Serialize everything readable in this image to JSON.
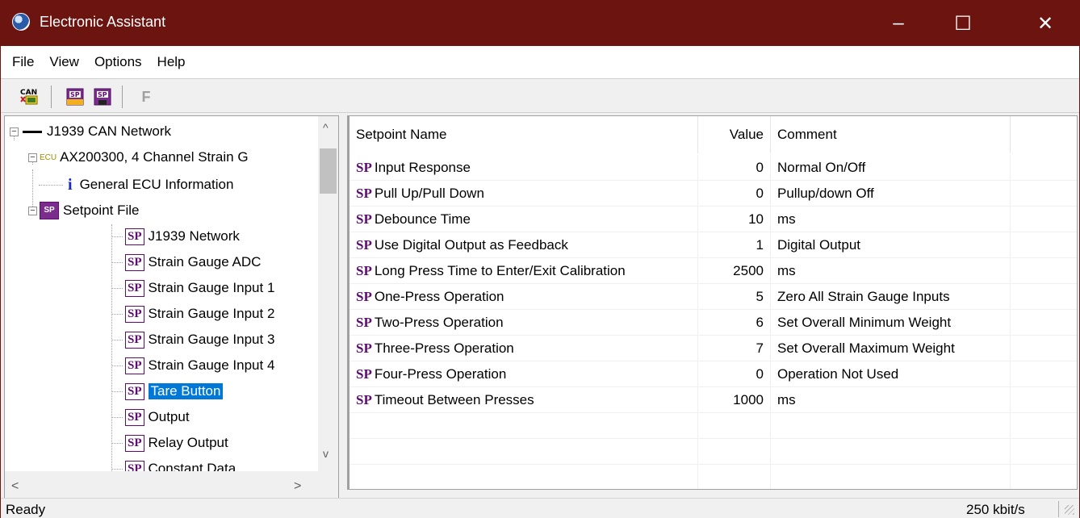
{
  "window": {
    "title": "Electronic Assistant",
    "controls": {
      "minimize": "–",
      "maximize": "☐",
      "close": "✕"
    }
  },
  "menu": [
    "File",
    "View",
    "Options",
    "Help"
  ],
  "toolbar": {
    "buttons": [
      {
        "icon": "can-network-icon",
        "label": "CAN"
      },
      {
        "icon": "open-setpoint-file-icon",
        "label": "SP"
      },
      {
        "icon": "save-setpoint-file-icon",
        "label": "SP"
      },
      {
        "icon": "flash-f-icon",
        "label": "F"
      }
    ]
  },
  "tree": {
    "network": {
      "label": "J1939 CAN Network",
      "expander": "−"
    },
    "ecu": {
      "label": "AX200300, 4 Channel Strain G",
      "prefix": "ECU",
      "expander": "−"
    },
    "general": {
      "label": "General ECU Information",
      "icon": "i"
    },
    "setpoint_file": {
      "label": "Setpoint File",
      "icon": "SP",
      "expander": "−"
    },
    "children": [
      {
        "label": "J1939 Network",
        "icon": "SP"
      },
      {
        "label": "Strain Gauge ADC",
        "icon": "SP"
      },
      {
        "label": "Strain Gauge Input 1",
        "icon": "SP"
      },
      {
        "label": "Strain Gauge Input 2",
        "icon": "SP"
      },
      {
        "label": "Strain Gauge Input 3",
        "icon": "SP"
      },
      {
        "label": "Strain Gauge Input 4",
        "icon": "SP"
      },
      {
        "label": "Tare Button",
        "icon": "SP",
        "selected": true
      },
      {
        "label": "Output",
        "icon": "SP"
      },
      {
        "label": "Relay Output",
        "icon": "SP"
      },
      {
        "label": "Constant Data",
        "icon": "SP"
      }
    ],
    "scroll": {
      "up": "^",
      "down": "v",
      "left": "<",
      "right": ">"
    }
  },
  "setpoints": {
    "columns": [
      "Setpoint Name",
      "Value",
      "Comment"
    ],
    "prefix": "SP",
    "rows": [
      {
        "name": "Input Response",
        "value": "0",
        "comment": "Normal On/Off"
      },
      {
        "name": "Pull Up/Pull Down",
        "value": "0",
        "comment": "Pullup/down Off"
      },
      {
        "name": "Debounce Time",
        "value": "10",
        "comment": "ms"
      },
      {
        "name": "Use Digital Output as Feedback",
        "value": "1",
        "comment": "Digital Output"
      },
      {
        "name": "Long Press Time to Enter/Exit Calibration",
        "value": "2500",
        "comment": "ms"
      },
      {
        "name": "One-Press Operation",
        "value": "5",
        "comment": "Zero All Strain Gauge Inputs"
      },
      {
        "name": "Two-Press Operation",
        "value": "6",
        "comment": "Set Overall Minimum Weight"
      },
      {
        "name": "Three-Press Operation",
        "value": "7",
        "comment": "Set Overall Maximum Weight"
      },
      {
        "name": "Four-Press Operation",
        "value": "0",
        "comment": "Operation Not Used"
      },
      {
        "name": "Timeout Between Presses",
        "value": "1000",
        "comment": "ms"
      }
    ]
  },
  "status": {
    "text": "Ready",
    "bitrate": "250 kbit/s"
  },
  "colors": {
    "title_bar": "#6b1410",
    "selection": "#0078d7",
    "sp_purple": "#5f0b72"
  }
}
